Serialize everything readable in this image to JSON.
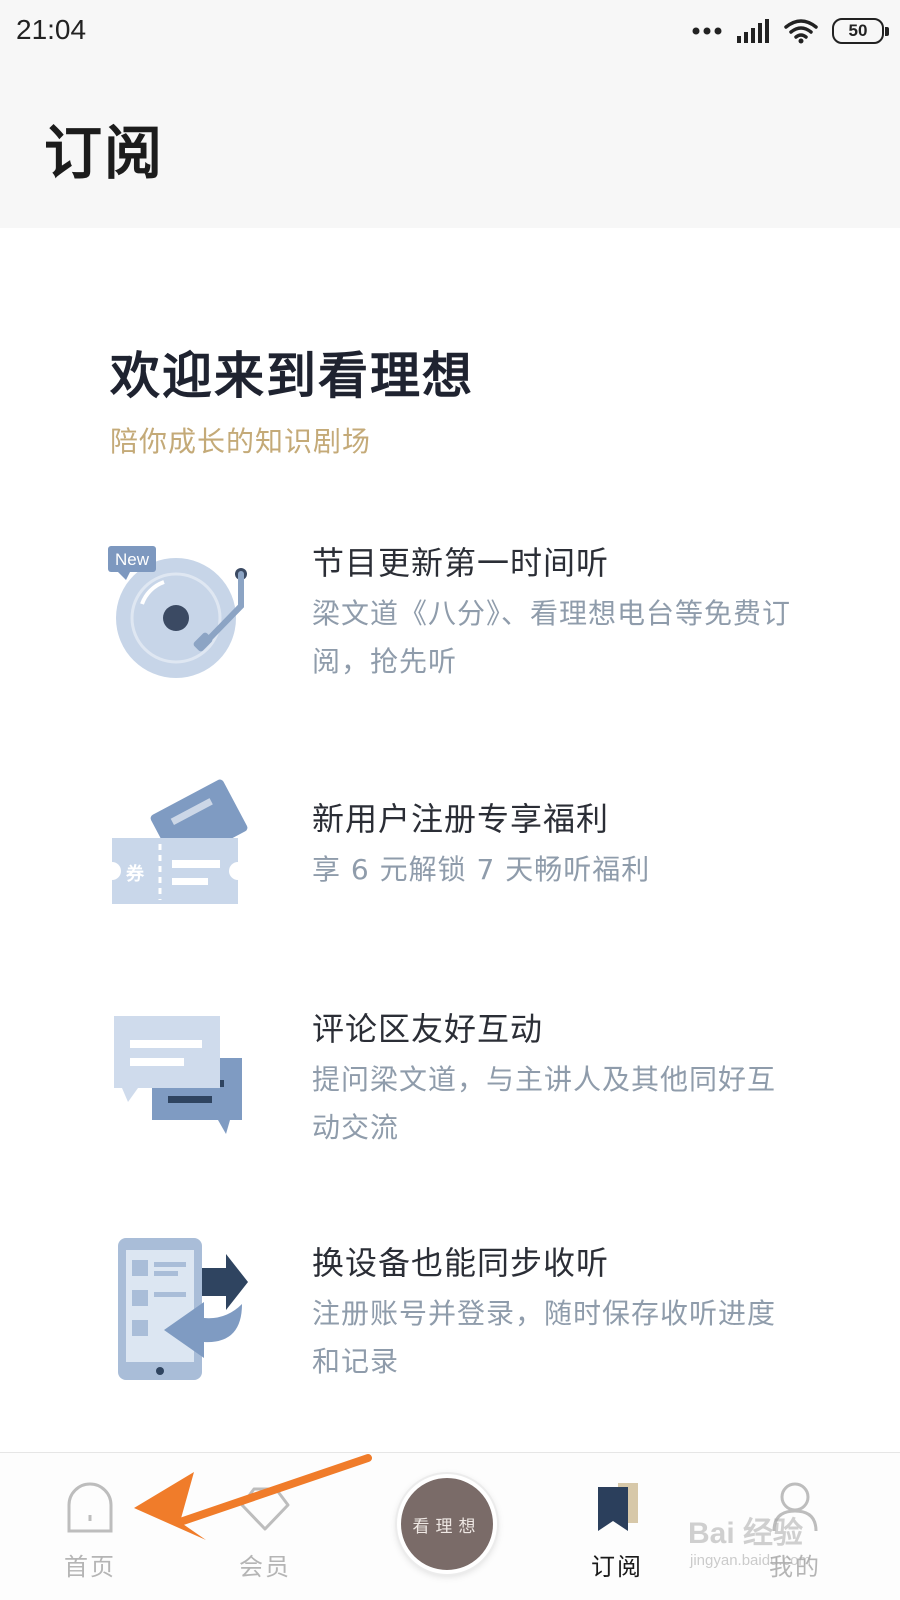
{
  "status_bar": {
    "time": "21:04",
    "battery": "50"
  },
  "header": {
    "title": "订阅"
  },
  "welcome": {
    "title": "欢迎来到看理想",
    "subtitle": "陪你成长的知识剧场"
  },
  "features": [
    {
      "icon": "record-player-icon",
      "badge": "New",
      "title": "节目更新第一时间听",
      "description": "梁文道《八分》、看理想电台等免费订阅，抢先听"
    },
    {
      "icon": "ticket-coupon-icon",
      "badge": "券",
      "title": "新用户注册专享福利",
      "description": "享 6 元解锁 7 天畅听福利"
    },
    {
      "icon": "chat-bubbles-icon",
      "title": "评论区友好互动",
      "description": "提问梁文道，与主讲人及其他同好互动交流"
    },
    {
      "icon": "device-sync-icon",
      "title": "换设备也能同步收听",
      "description": "注册账号并登录，随时保存收听进度和记录"
    }
  ],
  "tabbar": {
    "tabs": [
      {
        "label": "首页",
        "icon": "home-arch-icon",
        "active": false
      },
      {
        "label": "会员",
        "icon": "diamond-icon",
        "active": false
      },
      {
        "label": "看理想",
        "icon": "center-logo",
        "active": false
      },
      {
        "label": "订阅",
        "icon": "bookmark-icon",
        "active": true
      },
      {
        "label": "我的",
        "icon": "person-icon",
        "active": false
      }
    ],
    "center_label": "看理想"
  },
  "watermark": {
    "text": "Bai 经验",
    "url": "jingyan.baidu.com"
  },
  "colors": {
    "accent_gold": "#c4aa78",
    "icon_blue": "#a9bdd8",
    "icon_navy": "#2f4460",
    "center_button": "#7a6b68",
    "annotation_arrow": "#f07c2a"
  }
}
